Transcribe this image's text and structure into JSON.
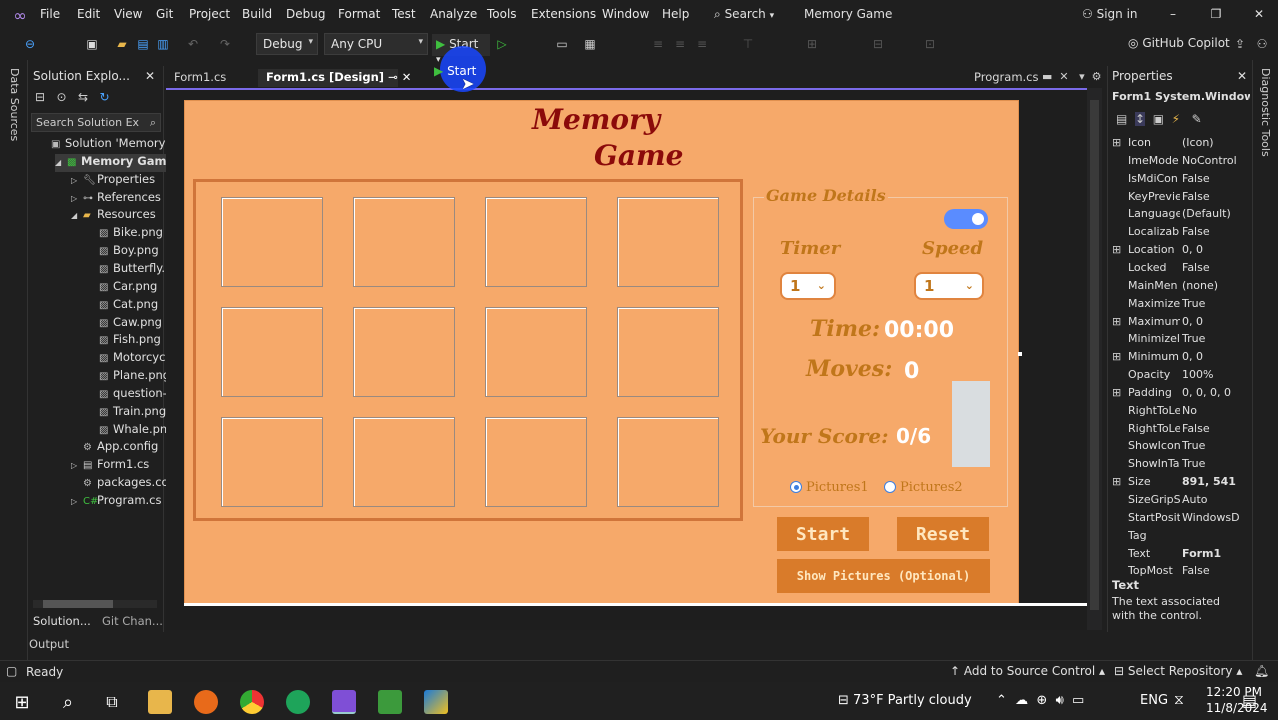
{
  "titlebar": {
    "menus": [
      "File",
      "Edit",
      "View",
      "Git",
      "Project",
      "Build",
      "Debug",
      "Format",
      "Test",
      "Analyze",
      "Tools",
      "Extensions",
      "Window",
      "Help"
    ],
    "search_label": "Search",
    "solution_name": "Memory Game",
    "sign_in": "Sign in"
  },
  "toolbar": {
    "config": "Debug",
    "platform": "Any CPU",
    "start_label": "Start",
    "copilot": "GitHub Copilot"
  },
  "left_strip": {
    "label": "Data Sources"
  },
  "solution_explorer": {
    "title": "Solution Explo...",
    "search_placeholder": "Search Solution Ex",
    "items": [
      {
        "label": "Solution 'Memory G",
        "level": 0,
        "icon": "solution-icon"
      },
      {
        "label": "Memory Game",
        "level": 1,
        "icon": "csharp-project-icon"
      },
      {
        "label": "Properties",
        "level": 2,
        "icon": "wrench-icon"
      },
      {
        "label": "References",
        "level": 2,
        "icon": "references-icon"
      },
      {
        "label": "Resources",
        "level": 2,
        "icon": "folder-icon"
      },
      {
        "label": "Bike.png",
        "level": 3,
        "icon": "image-icon"
      },
      {
        "label": "Boy.png",
        "level": 3,
        "icon": "image-icon"
      },
      {
        "label": "Butterfly.p",
        "level": 3,
        "icon": "image-icon"
      },
      {
        "label": "Car.png",
        "level": 3,
        "icon": "image-icon"
      },
      {
        "label": "Cat.png",
        "level": 3,
        "icon": "image-icon"
      },
      {
        "label": "Caw.png",
        "level": 3,
        "icon": "image-icon"
      },
      {
        "label": "Fish.png",
        "level": 3,
        "icon": "image-icon"
      },
      {
        "label": "Motorcycl",
        "level": 3,
        "icon": "image-icon"
      },
      {
        "label": "Plane.png",
        "level": 3,
        "icon": "image-icon"
      },
      {
        "label": "question-(",
        "level": 3,
        "icon": "image-icon"
      },
      {
        "label": "Train.png",
        "level": 3,
        "icon": "image-icon"
      },
      {
        "label": "Whale.png",
        "level": 3,
        "icon": "image-icon"
      },
      {
        "label": "App.config",
        "level": 2,
        "icon": "config-icon"
      },
      {
        "label": "Form1.cs",
        "level": 2,
        "icon": "form-icon"
      },
      {
        "label": "packages.con",
        "level": 2,
        "icon": "config-icon"
      },
      {
        "label": "Program.cs",
        "level": 2,
        "icon": "csharp-file-icon"
      }
    ],
    "bottom_tabs": [
      "Solution...",
      "Git Chan..."
    ]
  },
  "doc_tabs": [
    {
      "label": "Form1.cs",
      "active": false
    },
    {
      "label": "Form1.cs [Design]",
      "active": true
    },
    {
      "label": "Program.cs",
      "active": false
    }
  ],
  "form": {
    "title_line1": "Memory",
    "title_line2": "Game",
    "details_label": "Game Details",
    "toggle_on": true,
    "timer_label": "Timer",
    "speed_label": "Speed",
    "timer_value": "1",
    "speed_value": "1",
    "time_label": "Time:",
    "time_value": "00:00",
    "moves_label": "Moves:",
    "moves_value": "0",
    "score_label": "Your Score:",
    "score_value": "0/6",
    "radio1": "Pictures1",
    "radio2": "Pictures2",
    "radio1_checked": true,
    "start_button": "Start",
    "reset_button": "Reset",
    "show_pictures_button": "Show Pictures (Optional)",
    "card_count": 12
  },
  "properties": {
    "title": "Properties",
    "object": "Form1  System.Window",
    "rows": [
      {
        "name": "Icon",
        "value": "(Icon)",
        "expand": true
      },
      {
        "name": "ImeMode",
        "value": "NoControl",
        "expand": false
      },
      {
        "name": "IsMdiCon",
        "value": "False",
        "expand": false
      },
      {
        "name": "KeyPrevie",
        "value": "False",
        "expand": false
      },
      {
        "name": "Language",
        "value": "(Default)",
        "expand": false
      },
      {
        "name": "Localizabl",
        "value": "False",
        "expand": false
      },
      {
        "name": "Location",
        "value": "0, 0",
        "expand": true
      },
      {
        "name": "Locked",
        "value": "False",
        "expand": false
      },
      {
        "name": "MainMen",
        "value": "(none)",
        "expand": false
      },
      {
        "name": "Maximize",
        "value": "True",
        "expand": false
      },
      {
        "name": "Maximum",
        "value": "0, 0",
        "expand": true
      },
      {
        "name": "Minimizel",
        "value": "True",
        "expand": false
      },
      {
        "name": "Minimum",
        "value": "0, 0",
        "expand": true
      },
      {
        "name": "Opacity",
        "value": "100%",
        "expand": false
      },
      {
        "name": "Padding",
        "value": "0, 0, 0, 0",
        "expand": true
      },
      {
        "name": "RightToLe",
        "value": "No",
        "expand": false
      },
      {
        "name": "RightToLe",
        "value": "False",
        "expand": false
      },
      {
        "name": "ShowIcon",
        "value": "True",
        "expand": false
      },
      {
        "name": "ShowInTa",
        "value": "True",
        "expand": false
      },
      {
        "name": "Size",
        "value": "891, 541",
        "expand": true
      },
      {
        "name": "SizeGripSt",
        "value": "Auto",
        "expand": false
      },
      {
        "name": "StartPositi",
        "value": "WindowsD",
        "expand": false
      },
      {
        "name": "Tag",
        "value": "",
        "expand": false
      },
      {
        "name": "Text",
        "value": "Form1",
        "expand": false
      },
      {
        "name": "TopMost",
        "value": "False",
        "expand": false
      }
    ],
    "desc_title": "Text",
    "desc_body": "The text associated with the control."
  },
  "right_strip": {
    "label": "Diagnostic Tools"
  },
  "output_label": "Output",
  "status": {
    "ready": "Ready",
    "source_control": "Add to Source Control",
    "repo": "Select Repository"
  },
  "taskbar": {
    "weather": "73°F  Partly cloudy",
    "lang": "ENG",
    "time": "12:20 PM",
    "date": "11/8/2024"
  }
}
